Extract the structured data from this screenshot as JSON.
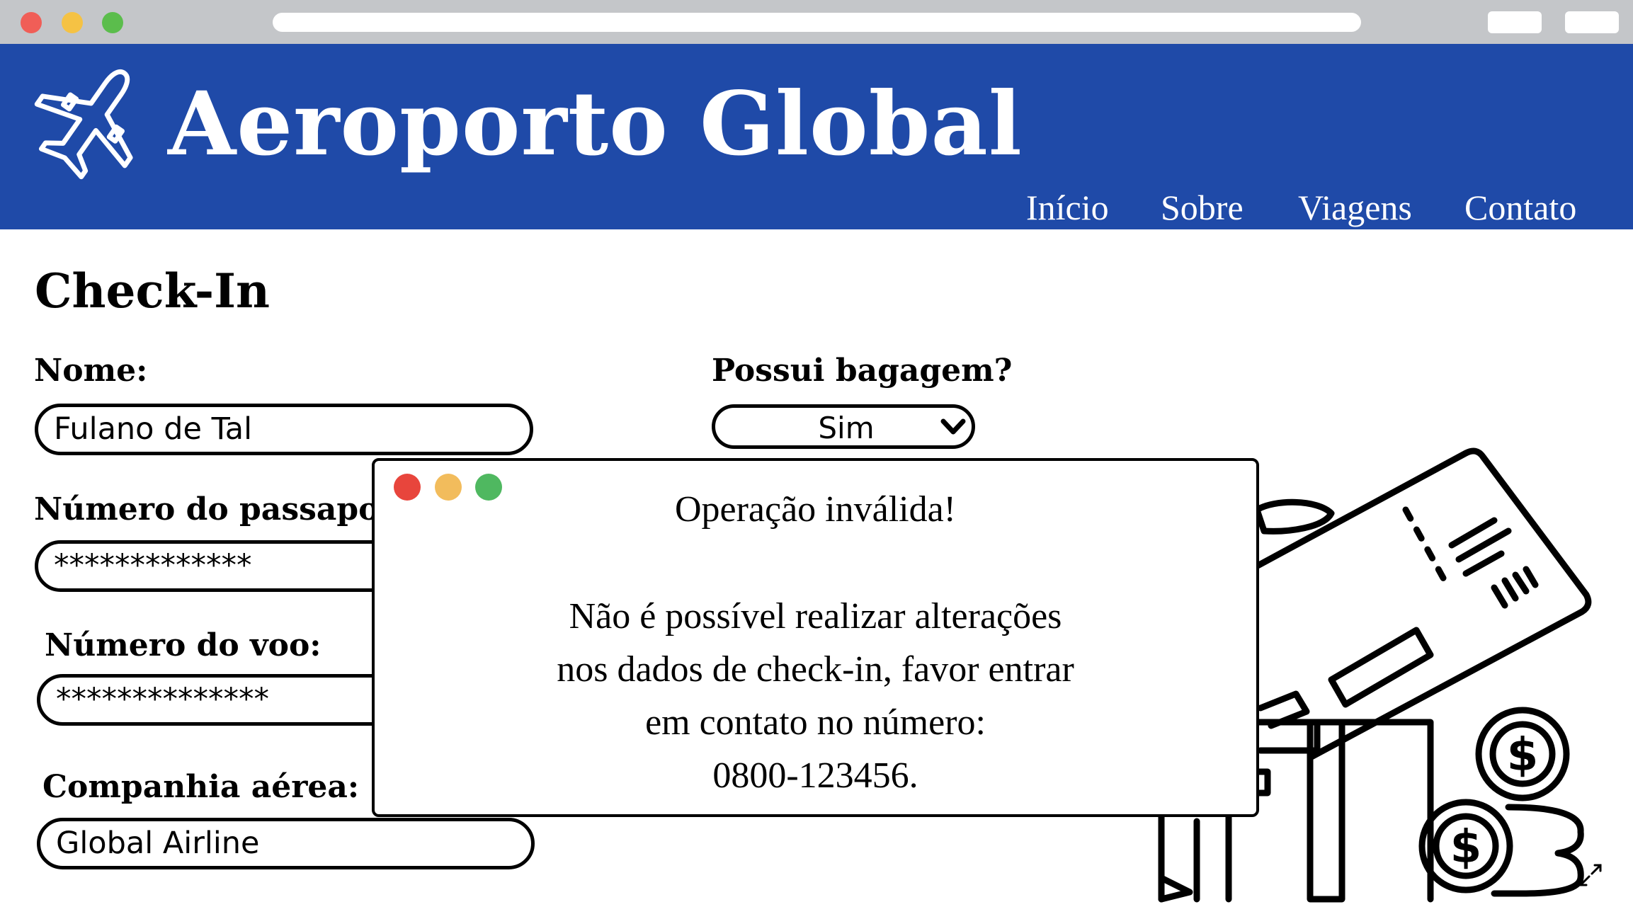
{
  "browser": {
    "traffic_lights": {
      "close": "#f05e57",
      "minimize": "#f5c244",
      "maximize": "#5bbd4c"
    },
    "chrome_color": "#c4c6c9"
  },
  "header": {
    "background": "#1f4aa8",
    "logo_icon": "airplane-icon",
    "title": "Aeroporto Global",
    "nav": [
      {
        "label": "Início"
      },
      {
        "label": "Sobre"
      },
      {
        "label": "Viagens"
      },
      {
        "label": "Contato"
      }
    ]
  },
  "form": {
    "title": "Check-In",
    "name_label": "Nome:",
    "name_value": "Fulano de Tal",
    "passport_label": "Número do passaporte:",
    "passport_value": "*************",
    "flight_label": "Número do voo:",
    "flight_value": "**************",
    "airline_label": "Companhia aérea:",
    "airline_value": "Global Airline",
    "baggage_label": "Possui bagagem?",
    "baggage_value": "Sim"
  },
  "modal": {
    "title": "Operação inválida!",
    "lines": [
      "Não é possível realizar alterações",
      "nos dados de check-in, favor entrar",
      "em contato no número:",
      "0800-123456."
    ],
    "traffic_lights": {
      "close": "#e8453c",
      "minimize": "#f2bc5c",
      "maximize": "#4fb860"
    }
  },
  "illustration": {
    "icons": [
      "ticket-icon",
      "airplane-icon",
      "suitcase-icon",
      "dollar-coin-icon"
    ]
  },
  "corner_icon": "expand-icon"
}
